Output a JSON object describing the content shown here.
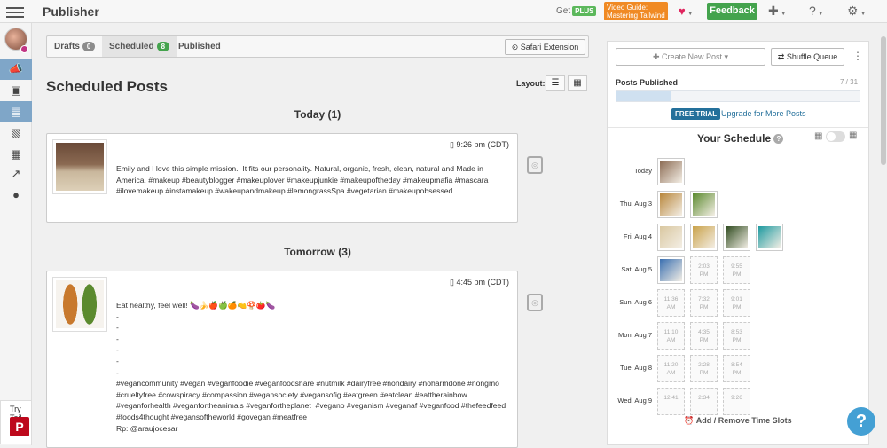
{
  "app": {
    "title": "Publisher"
  },
  "topbar": {
    "get_label": "Get",
    "plus_label": "PLUS",
    "video_guide": "Video Guide:",
    "video_guide_2": "Mastering Tailwind",
    "feedback_label": "Feedback"
  },
  "tabs": [
    {
      "label": "Drafts",
      "count": "0"
    },
    {
      "label": "Scheduled",
      "count": "8"
    },
    {
      "label": "Published"
    }
  ],
  "safari_label": "Safari Extension",
  "page_title": "Scheduled Posts",
  "layout_label": "Layout:",
  "sections": [
    {
      "heading": "Today (1)",
      "post": {
        "time": "9:26 pm (CDT)",
        "text": "Emily and I love this simple mission.  It fits our personality. Natural, organic, fresh, clean, natural and Made in America. #makeup #beautyblogger #makeuplover #makeupjunkie #makeupoftheday #makeupmafia #mascara #ilovemakeup #instamakeup #wakeupandmakeup #lemongrassSpa #vegetarian #makeupobsessed"
      }
    },
    {
      "heading": "Tomorrow (3)",
      "post": {
        "time": "4:45 pm (CDT)",
        "text": "Eat healthy, feel well! 🍆🍌🍎🍏🍊🍋🍄🍅🍆\n-\n-\n-\n-\n-\n-\n#vegancommunity #vegan #veganfoodie #veganfoodshare #nutmilk #dairyfree #nondairy #noharmdone #nongmo #crueltyfree #cowspiracy #compassion #vegansociety #vegansofig #eatgreen #eatclean #eattherainbow #veganforhealth #veganfortheanimals #veganfortheplanet  #vegano #veganism #veganaf #veganfood #thefeedfeed #foods4thought #vegansoftheworld #govegan #meatfree\nRp: @araujocesar"
      }
    }
  ],
  "try_label": "Try Tail",
  "right_panel": {
    "create_label": "Create New Post",
    "shuffle_label": "Shuffle Queue",
    "posts_published_label": "Posts Published",
    "posts_published_count": "7 / 31",
    "posts_published_fraction": 0.226,
    "free_trial_label": "FREE TRIAL",
    "upgrade_label": "Upgrade for More Posts",
    "schedule_title": "Your Schedule",
    "add_slots_label": "Add / Remove Time Slots",
    "schedule": [
      {
        "day": "Today",
        "slots": [
          {
            "img": true
          }
        ]
      },
      {
        "day": "Thu, Aug 3",
        "slots": [
          {
            "img": true
          },
          {
            "img": true
          }
        ]
      },
      {
        "day": "Fri, Aug 4",
        "slots": [
          {
            "img": true
          },
          {
            "img": true
          },
          {
            "img": true
          },
          {
            "img": true
          }
        ]
      },
      {
        "day": "Sat, Aug 5",
        "slots": [
          {
            "img": true
          },
          {
            "t": "2:03",
            "p": "PM"
          },
          {
            "t": "9:55",
            "p": "PM"
          }
        ]
      },
      {
        "day": "Sun, Aug 6",
        "slots": [
          {
            "t": "11:36",
            "p": "AM"
          },
          {
            "t": "7:32",
            "p": "PM"
          },
          {
            "t": "9:01",
            "p": "PM"
          }
        ]
      },
      {
        "day": "Mon, Aug 7",
        "slots": [
          {
            "t": "11:10",
            "p": "AM"
          },
          {
            "t": "4:35",
            "p": "PM"
          },
          {
            "t": "8:53",
            "p": "PM"
          }
        ]
      },
      {
        "day": "Tue, Aug 8",
        "slots": [
          {
            "t": "11:20",
            "p": "AM"
          },
          {
            "t": "2:28",
            "p": "PM"
          },
          {
            "t": "8:54",
            "p": "PM"
          }
        ]
      },
      {
        "day": "Wed, Aug 9",
        "slots": [
          {
            "t": "12:41",
            "p": ""
          },
          {
            "t": "2:34",
            "p": ""
          },
          {
            "t": "9:26",
            "p": ""
          }
        ]
      }
    ]
  },
  "colors": {
    "accent": "#44a34d",
    "link": "#24709b",
    "orange": "#f08a24",
    "help": "#44a0d4"
  }
}
